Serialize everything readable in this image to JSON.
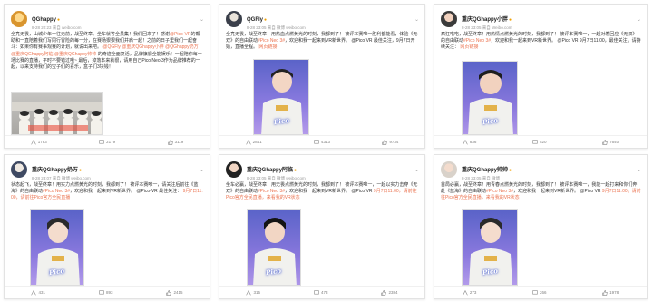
{
  "colors": {
    "accent": "#eb7350",
    "verified": "#f0a000",
    "slogan_glow": "#4a5fd0"
  },
  "posts": [
    {
      "id": "p1",
      "name": "QGhappy",
      "time": "8-28 20:23 来自 weibo.com",
      "text_plain": "全亮无畏，山城少年一往无前，战至终章。坐车就等全员集！我们回来了！感谢",
      "text_tag1": "@Pico-VR",
      "text_plain2": "的帮助和一直陪着我们写同行冒险的每一分，在赛场狠狠我们并肩一起！之前的日子里我们一起奋斗：如果你有赛事观赛的计划，就说出来吧。",
      "text_tags2": "@QGFly @重庆QGhappy小胖 @QGhappy奶万 @重庆QGhappy阿临 @重庆QGhappy帅帅",
      "text_plain3": "的奇迹全面复活，品牌旗舰全能娱乐！一起陪你每一场比赛的直播，平时不要错过哦~",
      "text_plain4": "最后，掉落本来就很，请用自己Pico Neo 3作为品牌推荐的一起，以来支持我们的宝子们的喜乐，盒子们3块钱！",
      "counts": [
        "1783",
        "2179",
        "3119"
      ]
    },
    {
      "id": "p2",
      "name": "QGFly",
      "time": "8-28 23:05 来自 微博 weibo.com",
      "text_plain": "全亮无畏，战至终章！用热血点燃黄光的时刻，我都到了！",
      "text_plain2": "被评本赛唯一胜利都能看，体验《无双》的自由联动",
      "text_tag1": "#Pico Neo 3#",
      "text_plain3": "，欢迎和我一起来到VR新世界。 @Pico VR",
      "text_plain4": "最佳关注，9月7日开始，直播全程。",
      "link": "网页链接",
      "counts": [
        "2841",
        "4313",
        "9734"
      ]
    },
    {
      "id": "p3",
      "name": "重庆QGhappy小胖",
      "time": "8-28 23:05 来自 Weibo.com",
      "text_plain": "疯狂吃吃，战至终章！用热情点燃黄光的时刻，我都到了！",
      "text_plain2": "被评本赛唯一，一起对着回应《无双》的自由联动",
      "text_tag1": "#Pico Neo 3#",
      "text_plain3": "，欢迎和我一起来到VR新世界。 @Pico VR",
      "text_plain4": "9月7日11:00，最佳关注，请持续关注：",
      "link": "网页链接",
      "counts": [
        "836",
        "520",
        "7640"
      ]
    },
    {
      "id": "p4",
      "name": "重庆QGhappy奶万",
      "time": "8-28 23:07 来自 微博 weibo.com",
      "text_plain": "状态起飞，战至终章！用实力点燃黄光的时刻，我都到了！",
      "text_plain2": "被评本赛唯一，请关注后前往《蓝海》的自由联动",
      "text_tag1": "#Pico Neo 3#",
      "text_plain3": "，欢迎和我一起来到VR新世界。 @Pico-VR 最佳关注：",
      "link": "9月7日11:00，请前往Pico官方全民直播",
      "counts": [
        "431",
        "893",
        "2415"
      ]
    },
    {
      "id": "p5",
      "name": "重庆QGhappy阿临",
      "time": "8-28 23:05 来自 微博 weibo.com",
      "text_plain": "坐车必赢，战至终章！用无畏点燃黄光的时刻，我都到了！",
      "text_plain2": "被评本赛唯一，一起以实力击穿《无双》的自由联动",
      "text_tag1": "#Pico Neo 3#",
      "text_plain3": "，欢迎和我一起来到VR新世界。 @Pico VR",
      "link": "9月7日11:00，请前往Pico官方全民直播，来看我的VR状态",
      "counts": [
        "315",
        "473",
        "2384"
      ]
    },
    {
      "id": "p6",
      "name": "重庆QGhappy帅帅",
      "time": "8-28 23:05 来自 微博",
      "text_plain": "首局必赢，战至终章！用青春点燃黄光的时刻，我都到了！",
      "text_plain2": "被评本赛唯一，我能一起打来和你们奔赴《蓝海》的自由联动",
      "text_tag1": "#Pico Neo 3#",
      "text_plain3": "，欢迎和我一起来到VR新世界。 @Pico VR",
      "link": "9月7日11:00，请前往Pico官方全民直播，来看我的VR状态",
      "counts": [
        "273",
        "266",
        "1978"
      ]
    }
  ]
}
